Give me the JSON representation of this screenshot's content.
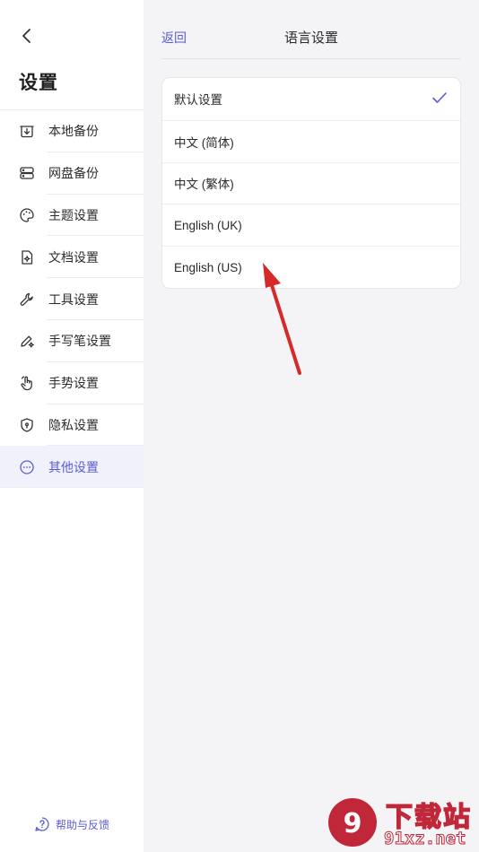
{
  "sidebar": {
    "title": "设置",
    "items": [
      {
        "label": "本地备份",
        "icon": "local-backup-icon"
      },
      {
        "label": "网盘备份",
        "icon": "cloud-backup-icon"
      },
      {
        "label": "主题设置",
        "icon": "palette-icon"
      },
      {
        "label": "文档设置",
        "icon": "document-settings-icon"
      },
      {
        "label": "工具设置",
        "icon": "wrench-icon"
      },
      {
        "label": "手写笔设置",
        "icon": "pen-settings-icon"
      },
      {
        "label": "手势设置",
        "icon": "hand-gesture-icon"
      },
      {
        "label": "隐私设置",
        "icon": "shield-icon"
      },
      {
        "label": "其他设置",
        "icon": "more-icon",
        "active": true
      }
    ],
    "help_label": "帮助与反馈"
  },
  "main": {
    "back_label": "返回",
    "title": "语言设置",
    "options": [
      {
        "label": "默认设置",
        "selected": true
      },
      {
        "label": "中文 (简体)",
        "selected": false
      },
      {
        "label": "中文 (繁体)",
        "selected": false
      },
      {
        "label": "English (UK)",
        "selected": false
      },
      {
        "label": "English (US)",
        "selected": false
      }
    ]
  },
  "watermark": {
    "brand_text": "下载站",
    "domain_text": "91xz.net"
  },
  "colors": {
    "accent": "#5b5bd6",
    "arrow": "#d42a2a",
    "sidebar_bg": "#ffffff",
    "main_bg": "#f4f4f6"
  }
}
